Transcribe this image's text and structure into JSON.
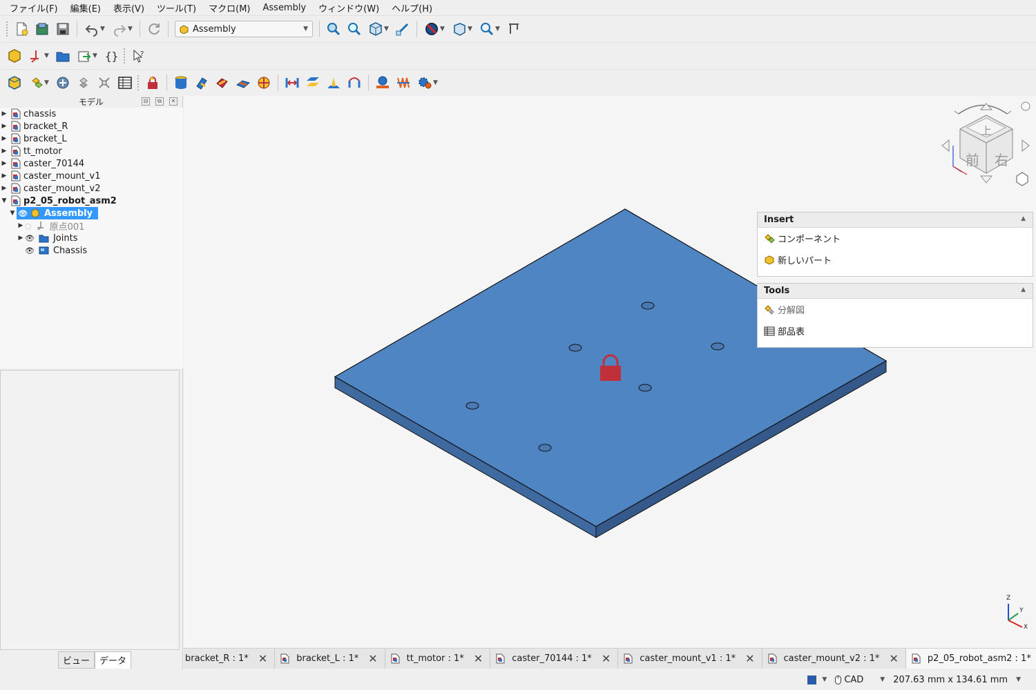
{
  "menu": [
    "ファイル(F)",
    "編集(E)",
    "表示(V)",
    "ツール(T)",
    "マクロ(M)",
    "Assembly",
    "ウィンドウ(W)",
    "ヘルプ(H)"
  ],
  "workbench": {
    "selected": "Assembly"
  },
  "tree_panel": {
    "title": "モデル"
  },
  "tree": {
    "docs": [
      "chassis",
      "bracket_R",
      "bracket_L",
      "tt_motor",
      "caster_70144",
      "caster_mount_v1",
      "caster_mount_v2",
      "p2_05_robot_asm2"
    ],
    "assembly": "Assembly",
    "origin": "原点001",
    "joints": "Joints",
    "chassis": "Chassis"
  },
  "panel_tabs": {
    "view": "ビュー",
    "data": "データ"
  },
  "navcube": {
    "top": "上",
    "front": "前",
    "right": "右"
  },
  "axis": {
    "z": "Z",
    "y": "Y",
    "x": "X"
  },
  "task_panel": {
    "insert": {
      "title": "Insert",
      "items": [
        "コンポーネント",
        "新しいパート"
      ]
    },
    "tools": {
      "title": "Tools",
      "items": [
        "分解図",
        "部品表"
      ]
    }
  },
  "doc_tabs": [
    "bracket_R : 1*",
    "bracket_L : 1*",
    "tt_motor : 1*",
    "caster_70144 : 1*",
    "caster_mount_v1 : 1*",
    "caster_mount_v2 : 1*",
    "p2_05_robot_asm2 : 1*"
  ],
  "status": {
    "nav_style": "CAD",
    "dimensions": "207.63 mm x 134.61 mm"
  },
  "colors": {
    "plate_top": "#5085c4",
    "plate_side": "#3f6aa0",
    "lock": "#c0303a",
    "selection": "#3399ff"
  }
}
